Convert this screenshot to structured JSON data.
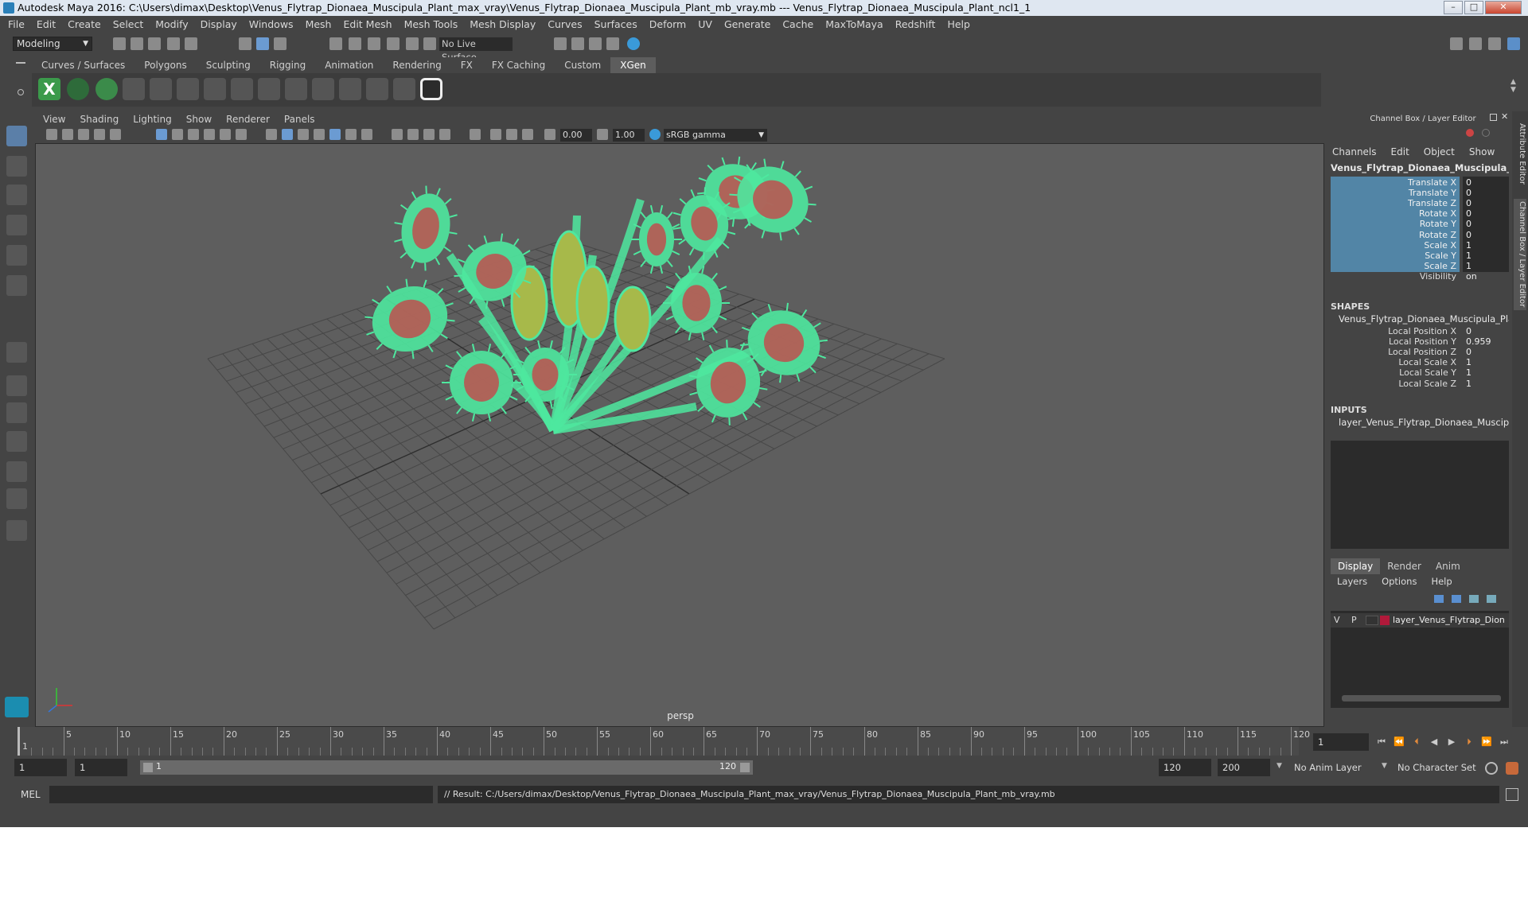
{
  "window": {
    "title": "Autodesk Maya 2016: C:\\Users\\dimax\\Desktop\\Venus_Flytrap_Dionaea_Muscipula_Plant_max_vray\\Venus_Flytrap_Dionaea_Muscipula_Plant_mb_vray.mb   ---   Venus_Flytrap_Dionaea_Muscipula_Plant_ncl1_1"
  },
  "menu": [
    "File",
    "Edit",
    "Create",
    "Select",
    "Modify",
    "Display",
    "Windows",
    "Mesh",
    "Edit Mesh",
    "Mesh Tools",
    "Mesh Display",
    "Curves",
    "Surfaces",
    "Deform",
    "UV",
    "Generate",
    "Cache",
    "MaxToMaya",
    "Redshift",
    "Help"
  ],
  "toolbar": {
    "mode": "Modeling",
    "live_surface": "No Live Surface"
  },
  "shelf_tabs": [
    "Curves / Surfaces",
    "Polygons",
    "Sculpting",
    "Rigging",
    "Animation",
    "Rendering",
    "FX",
    "FX Caching",
    "Custom",
    "XGen"
  ],
  "shelf_active": "XGen",
  "viewport": {
    "menu": [
      "View",
      "Shading",
      "Lighting",
      "Show",
      "Renderer",
      "Panels"
    ],
    "exposure": "0.00",
    "gamma": "1.00",
    "colorspace": "sRGB gamma",
    "camera": "persp"
  },
  "channel_box": {
    "header": "Channel Box / Layer Editor",
    "menu": [
      "Channels",
      "Edit",
      "Object",
      "Show"
    ],
    "object": "Venus_Flytrap_Dionaea_Muscipula_Plan...",
    "attrs": [
      {
        "label": "Translate X",
        "value": "0"
      },
      {
        "label": "Translate Y",
        "value": "0"
      },
      {
        "label": "Translate Z",
        "value": "0"
      },
      {
        "label": "Rotate X",
        "value": "0"
      },
      {
        "label": "Rotate Y",
        "value": "0"
      },
      {
        "label": "Rotate Z",
        "value": "0"
      },
      {
        "label": "Scale X",
        "value": "1"
      },
      {
        "label": "Scale Y",
        "value": "1"
      },
      {
        "label": "Scale Z",
        "value": "1"
      },
      {
        "label": "Visibility",
        "value": "on"
      }
    ],
    "shapes_title": "SHAPES",
    "shape_name": "Venus_Flytrap_Dionaea_Muscipula_Pla...",
    "shape_attrs": [
      {
        "label": "Local Position X",
        "value": "0"
      },
      {
        "label": "Local Position Y",
        "value": "0.959"
      },
      {
        "label": "Local Position Z",
        "value": "0"
      },
      {
        "label": "Local Scale X",
        "value": "1"
      },
      {
        "label": "Local Scale Y",
        "value": "1"
      },
      {
        "label": "Local Scale Z",
        "value": "1"
      }
    ],
    "inputs_title": "INPUTS",
    "input_name": "layer_Venus_Flytrap_Dionaea_Muscipu..."
  },
  "layer_editor": {
    "tabs": [
      "Display",
      "Render",
      "Anim"
    ],
    "menu": [
      "Layers",
      "Options",
      "Help"
    ],
    "layer": {
      "v": "V",
      "p": "P",
      "name": "layer_Venus_Flytrap_Dion",
      "color": "#b0193a"
    }
  },
  "side_tabs": [
    "Attribute Editor",
    "Channel Box / Layer Editor"
  ],
  "timeline": {
    "ticks": [
      "5",
      "10",
      "15",
      "20",
      "25",
      "30",
      "35",
      "40",
      "45",
      "50",
      "55",
      "60",
      "65",
      "70",
      "75",
      "80",
      "85",
      "90",
      "95",
      "100",
      "105",
      "110",
      "115",
      "120"
    ],
    "start_label": "1",
    "current": "1"
  },
  "range": {
    "start": "1",
    "start2": "1",
    "slider_start": "1",
    "slider_end": "120",
    "end": "120",
    "max": "200",
    "anim_layer": "No Anim Layer",
    "char_set": "No Character Set"
  },
  "command": {
    "lang": "MEL",
    "result": "// Result: C:/Users/dimax/Desktop/Venus_Flytrap_Dionaea_Muscipula_Plant_max_vray/Venus_Flytrap_Dionaea_Muscipula_Plant_mb_vray.mb"
  },
  "colors": {
    "accent_highlight": "#5285a6",
    "plant_wire": "#4ee89f",
    "trap_inner": "#c6464a"
  }
}
